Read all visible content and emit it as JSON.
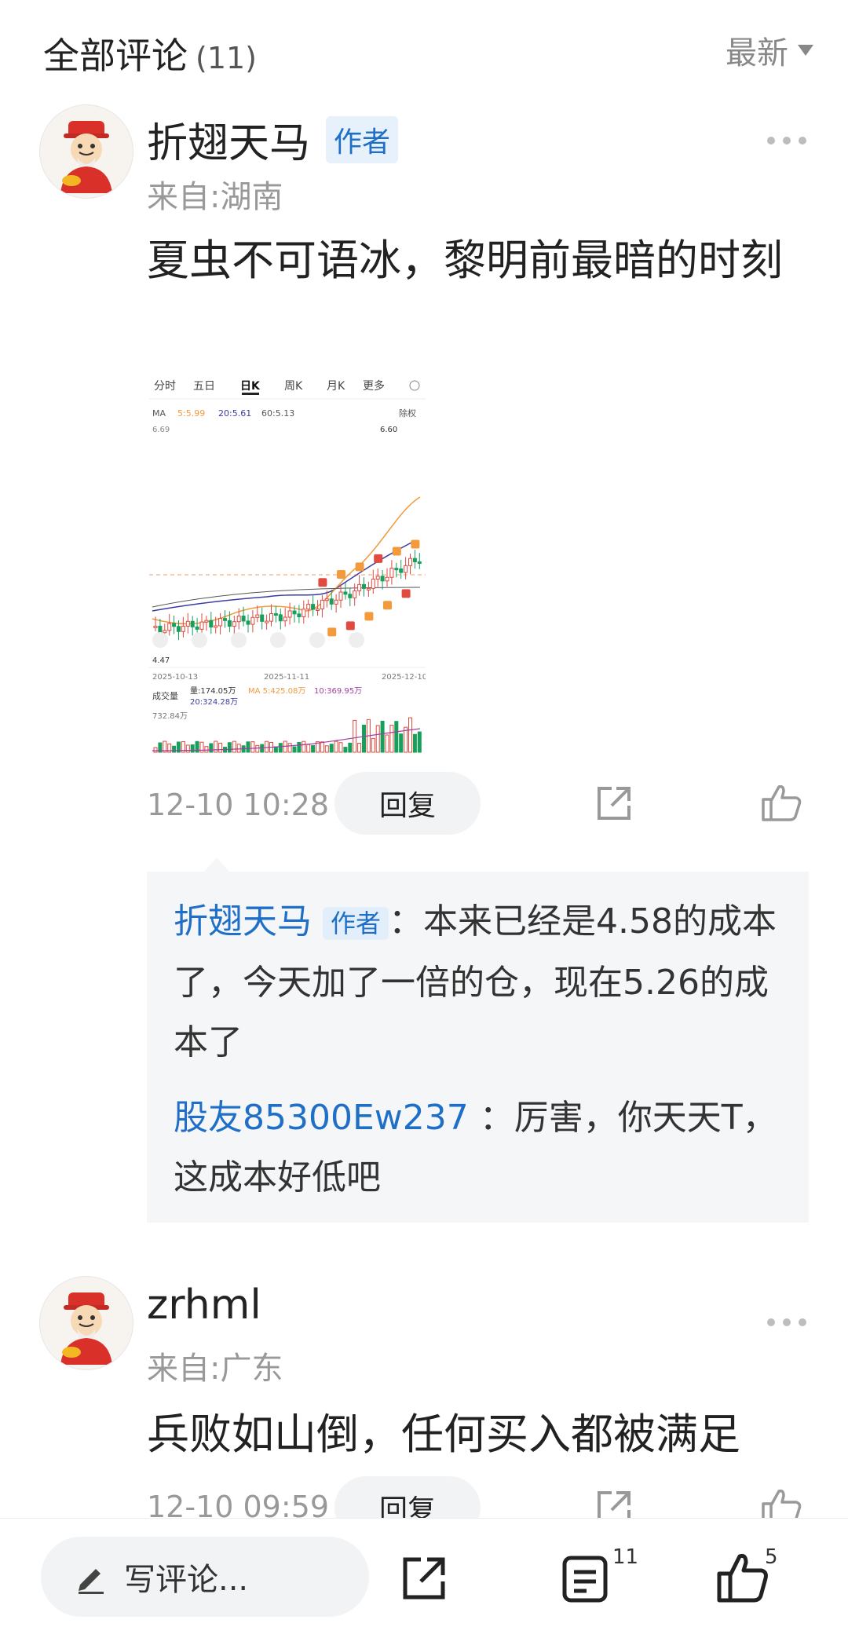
{
  "header": {
    "title": "全部评论",
    "count": "(11)",
    "sort_label": "最新"
  },
  "comments": [
    {
      "username": "折翅天马",
      "author_tag": "作者",
      "location": "来自:湖南",
      "text": "夏虫不可语冰，黎明前最暗的时刻",
      "time": "12-10 10:28",
      "reply_label": "回复",
      "chart": {
        "tabs": [
          "分时",
          "五日",
          "日K",
          "周K",
          "月K",
          "更多"
        ],
        "ma_label": "MA",
        "ma5": "5:5.99",
        "ma20": "20:5.61",
        "ma60": "60:5.13",
        "adjust_label": "除权",
        "price_high": "6.69",
        "peak_label": "6.60",
        "low_label": "4.47",
        "dates": [
          "2025-10-13",
          "2025-11-11",
          "2025-12-10"
        ],
        "volume_label": "成交量",
        "vol_value": "量:174.05万",
        "vol_ma5": "MA 5:425.08万",
        "vol_ma10": "10:369.95万",
        "vol_ma20": "20:324.28万",
        "vol_axis": "732.84万"
      },
      "replies": [
        {
          "name": "折翅天马",
          "tag": "作者",
          "text": "：本来已经是4.58的成本了，今天加了一倍的仓，现在5.26的成本了"
        },
        {
          "name": "股友85300Ew237",
          "text": "：厉害，你天天T，这成本好低吧"
        }
      ]
    },
    {
      "username": "zrhml",
      "location": "来自:广东",
      "text": "兵败如山倒，任何买入都被满足",
      "time": "12-10 09:59",
      "reply_label": "回复"
    }
  ],
  "bottom_bar": {
    "write_placeholder": "写评论...",
    "comment_count": "11",
    "like_count": "5"
  },
  "colors": {
    "accent_blue": "#1f6fc6",
    "candle_up": "#e04a3f",
    "candle_down": "#17a05d",
    "marker_orange": "#f39a3c"
  }
}
